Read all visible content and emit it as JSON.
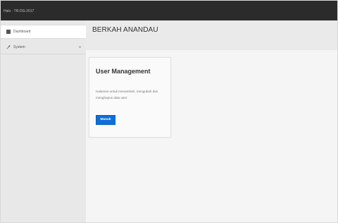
{
  "topbar": {
    "brand_text": "Halo · TR-DG-2017"
  },
  "sidebar": {
    "items": [
      {
        "label": "Dashboard",
        "icon": "dashboard-icon",
        "active": true
      },
      {
        "label": "System",
        "icon": "wrench-icon",
        "active": false,
        "has_submenu": true
      }
    ]
  },
  "header": {
    "title": "BERKAH ANANDAU"
  },
  "card": {
    "title": "User Management",
    "description": "Halaman untuk menambah, mengubah dan menghapus data user.",
    "button_label": "Masuk",
    "button_color": "#0d6fd9"
  },
  "theme": {
    "topbar_color": "#2b2b2b",
    "sidebar_color": "#e8e8e8",
    "background_color": "#f5f5f5"
  }
}
